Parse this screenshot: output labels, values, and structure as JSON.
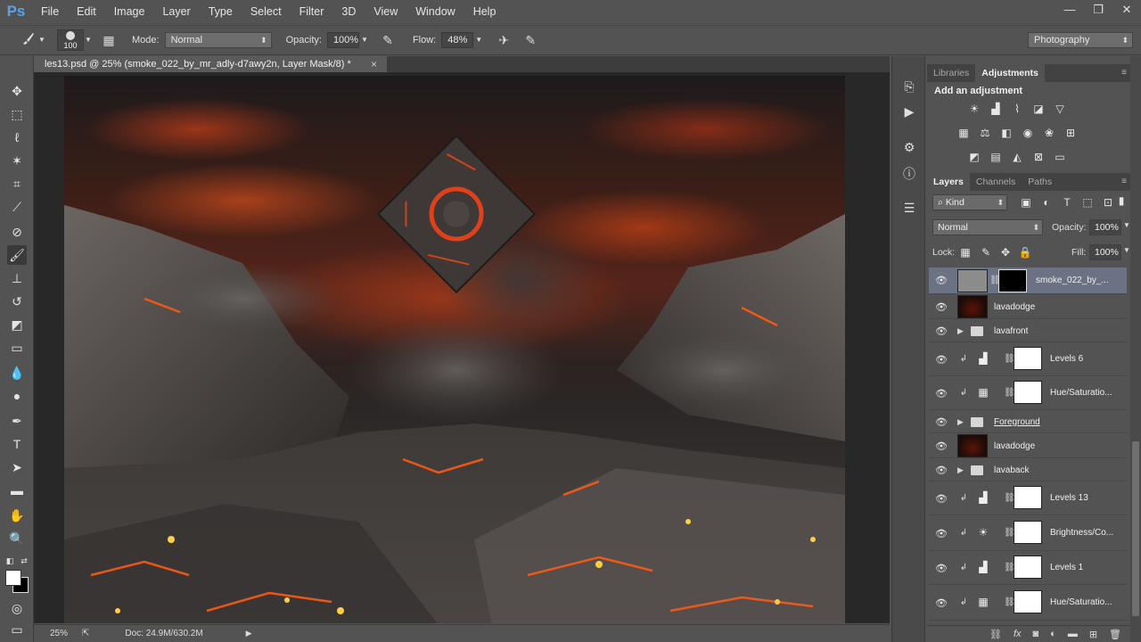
{
  "app": {
    "logo": "Ps",
    "menu": [
      "File",
      "Edit",
      "Image",
      "Layer",
      "Type",
      "Select",
      "Filter",
      "3D",
      "View",
      "Window",
      "Help"
    ],
    "window_controls": {
      "minimize": "—",
      "restore": "❐",
      "close": "✕"
    }
  },
  "options_bar": {
    "brush_size": "100",
    "mode_label": "Mode:",
    "mode_value": "Normal",
    "opacity_label": "Opacity:",
    "opacity_value": "100%",
    "flow_label": "Flow:",
    "flow_value": "48%",
    "workspace": "Photography"
  },
  "document": {
    "tab_title": "les13.psd @ 25% (smoke_022_by_mr_adly-d7awy2n, Layer Mask/8) *",
    "close": "×"
  },
  "status_bar": {
    "zoom": "25%",
    "doc_info": "Doc: 24.9M/630.2M"
  },
  "panels": {
    "top_tabs": [
      "Libraries",
      "Adjustments"
    ],
    "active_top_tab": "Adjustments",
    "adjustments_title": "Add an adjustment",
    "layer_tabs": [
      "Layers",
      "Channels",
      "Paths"
    ],
    "active_layer_tab": "Layers",
    "filter_kind": "Kind",
    "blend_mode": "Normal",
    "opacity_label": "Opacity:",
    "opacity_value": "100%",
    "lock_label": "Lock:",
    "fill_label": "Fill:",
    "fill_value": "100%"
  },
  "layers": [
    {
      "name": "smoke_022_by_...",
      "kind": "pixel-with-mask",
      "selected": true
    },
    {
      "name": "lavadodge",
      "kind": "pixel"
    },
    {
      "name": "lavafront",
      "kind": "group"
    },
    {
      "name": "Levels 6",
      "kind": "adjustment",
      "icon": "levels-icon",
      "clipped": true
    },
    {
      "name": "Hue/Saturatio...",
      "kind": "adjustment",
      "icon": "hue-saturation-icon",
      "clipped": true
    },
    {
      "name": "Foreground",
      "kind": "group"
    },
    {
      "name": "lavadodge",
      "kind": "pixel"
    },
    {
      "name": "lavaback",
      "kind": "group"
    },
    {
      "name": "Levels 13",
      "kind": "adjustment",
      "icon": "levels-icon",
      "clipped": true
    },
    {
      "name": "Brightness/Co...",
      "kind": "adjustment",
      "icon": "brightness-contrast-icon",
      "clipped": true
    },
    {
      "name": "Levels 1",
      "kind": "adjustment",
      "icon": "levels-icon",
      "clipped": true
    },
    {
      "name": "Hue/Saturatio...",
      "kind": "adjustment",
      "icon": "hue-saturation-icon",
      "clipped": true
    }
  ]
}
